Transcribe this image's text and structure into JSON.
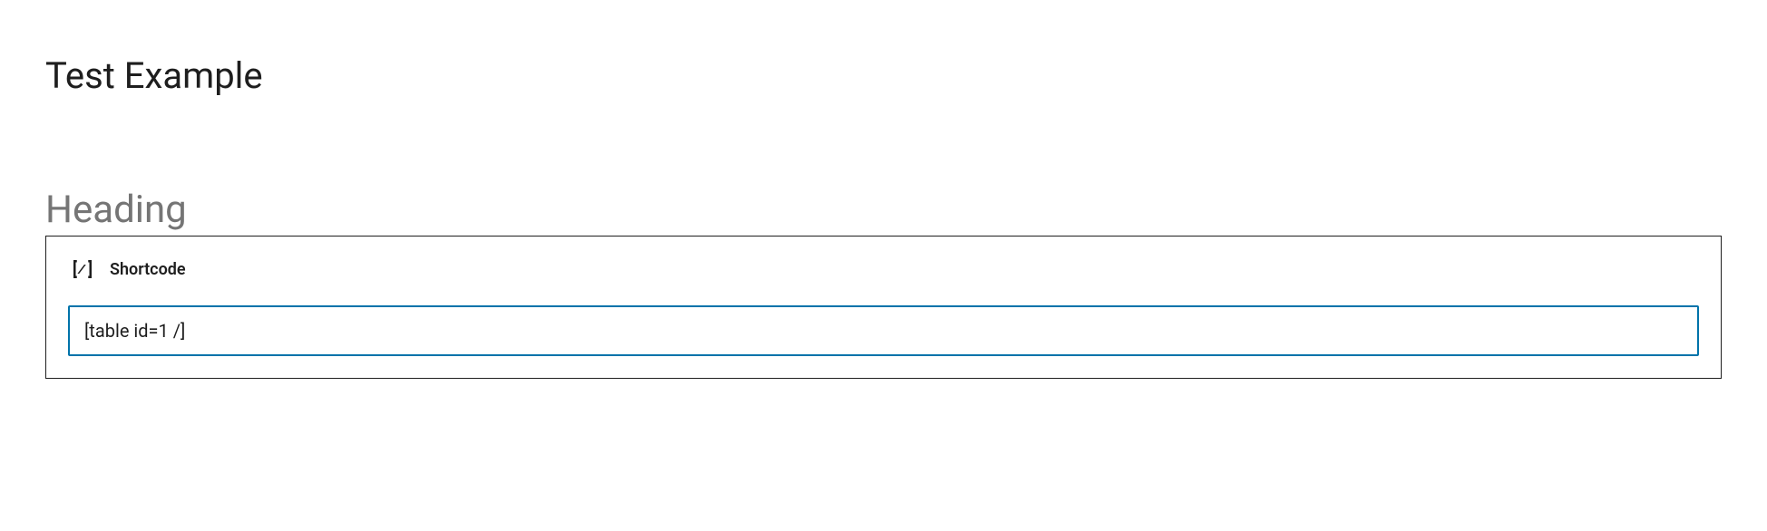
{
  "page": {
    "title": "Test Example"
  },
  "heading": {
    "placeholder": "Heading"
  },
  "block": {
    "label": "Shortcode",
    "icon": "shortcode-icon",
    "input_value": "[table id=1 /]"
  },
  "colors": {
    "accent": "#0073aa",
    "text": "#1e1e1e",
    "placeholder": "#757575"
  }
}
